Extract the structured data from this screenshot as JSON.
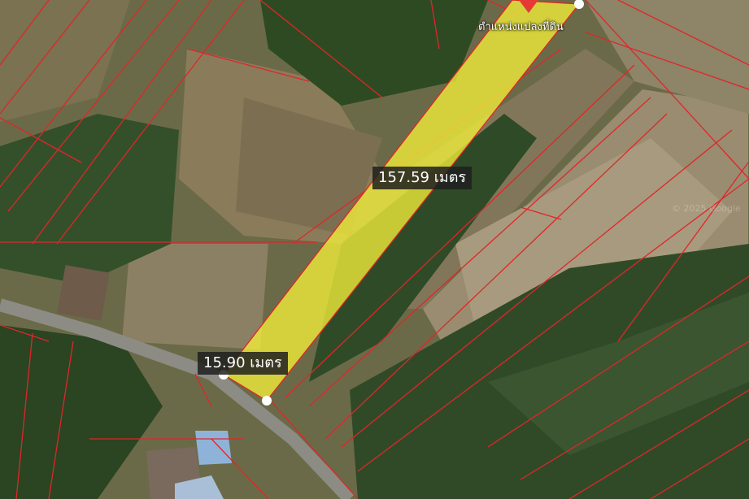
{
  "measurements": {
    "length_label": "157.59 เมตร",
    "width_label": "15.90 เมตร"
  },
  "pin": {
    "label": "ตำแหน่งแปลงที่ดิน",
    "icon": "map-pin-icon",
    "color": "#e53935"
  },
  "colors": {
    "parcel_fill": "#f2ee3a",
    "boundary_lines": "#e0262a",
    "vertex": "#ffffff"
  },
  "watermark": "© 2025 Google"
}
